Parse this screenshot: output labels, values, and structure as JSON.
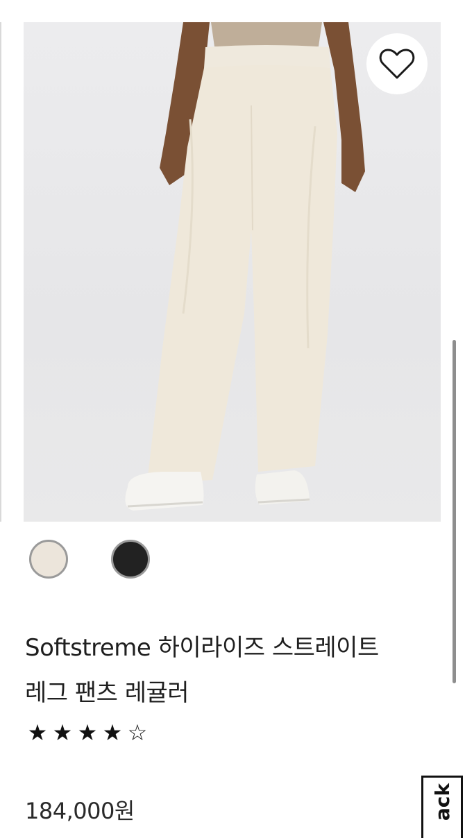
{
  "product": {
    "title_lines": [
      "Softstreme 하이라이즈 스트레이트",
      "레그 팬츠 레귤러"
    ],
    "rating": {
      "value": 4,
      "max": 5,
      "stars": [
        "★",
        "★",
        "★",
        "★",
        "☆"
      ]
    },
    "price": "184,000원",
    "image_icon": "product-photo-cream-pants",
    "favorite_icon": "heart-outline-icon"
  },
  "color_swatches": [
    {
      "icon": "swatch-cream",
      "color": "#ece5db",
      "selected": true
    },
    {
      "icon": "swatch-black",
      "color": "#222222",
      "selected": false
    }
  ],
  "feedback_tab": {
    "label": "ack"
  },
  "colors": {
    "background": "#ffffff",
    "text": "#1c1c1c",
    "photo_bg": "#e8e8ea"
  }
}
